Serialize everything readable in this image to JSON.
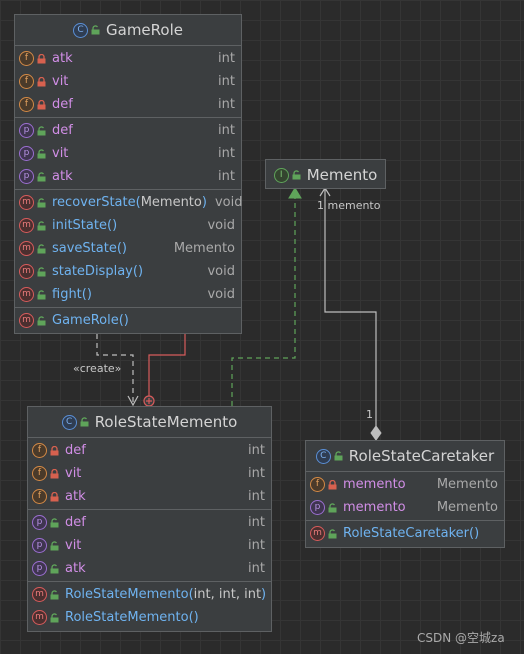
{
  "classes": [
    {
      "id": "gamerole",
      "name": "GameRole",
      "kind": "class",
      "sections": [
        [
          {
            "icon": "f",
            "access": "private",
            "name": "atk",
            "type": "int"
          },
          {
            "icon": "f",
            "access": "private",
            "name": "vit",
            "type": "int"
          },
          {
            "icon": "f",
            "access": "private",
            "name": "def",
            "type": "int"
          }
        ],
        [
          {
            "icon": "p",
            "access": "public",
            "name": "def",
            "type": "int"
          },
          {
            "icon": "p",
            "access": "public",
            "name": "vit",
            "type": "int"
          },
          {
            "icon": "p",
            "access": "public",
            "name": "atk",
            "type": "int"
          }
        ],
        [
          {
            "icon": "m",
            "access": "public",
            "name": "recoverState",
            "params": "Memento",
            "type": "void"
          },
          {
            "icon": "m",
            "access": "public",
            "name": "initState",
            "params": "",
            "type": "void"
          },
          {
            "icon": "m",
            "access": "public",
            "name": "saveState",
            "params": "",
            "type": "Memento"
          },
          {
            "icon": "m",
            "access": "public",
            "name": "stateDisplay",
            "params": "",
            "type": "void"
          },
          {
            "icon": "m",
            "access": "public",
            "name": "fight",
            "params": "",
            "type": "void"
          }
        ],
        [
          {
            "icon": "m",
            "access": "public",
            "name": "GameRole",
            "params": "",
            "type": ""
          }
        ]
      ]
    },
    {
      "id": "memento",
      "name": "Memento",
      "kind": "interface",
      "sections": []
    },
    {
      "id": "rolestatememento",
      "name": "RoleStateMemento",
      "kind": "class",
      "sections": [
        [
          {
            "icon": "f",
            "access": "private",
            "name": "def",
            "type": "int"
          },
          {
            "icon": "f",
            "access": "private",
            "name": "vit",
            "type": "int"
          },
          {
            "icon": "f",
            "access": "private",
            "name": "atk",
            "type": "int"
          }
        ],
        [
          {
            "icon": "p",
            "access": "public",
            "name": "def",
            "type": "int"
          },
          {
            "icon": "p",
            "access": "public",
            "name": "vit",
            "type": "int"
          },
          {
            "icon": "p",
            "access": "public",
            "name": "atk",
            "type": "int"
          }
        ],
        [
          {
            "icon": "m",
            "access": "public",
            "name": "RoleStateMemento",
            "params": "int, int, int",
            "type": ""
          },
          {
            "icon": "m",
            "access": "public",
            "name": "RoleStateMemento",
            "params": "",
            "type": ""
          }
        ]
      ]
    },
    {
      "id": "rolestatecaretaker",
      "name": "RoleStateCaretaker",
      "kind": "class",
      "sections": [
        [
          {
            "icon": "f",
            "access": "private",
            "name": "memento",
            "type": "Memento"
          },
          {
            "icon": "p",
            "access": "public",
            "name": "memento",
            "type": "Memento"
          }
        ],
        [
          {
            "icon": "m",
            "access": "public",
            "name": "RoleStateCaretaker",
            "params": "",
            "type": ""
          }
        ]
      ]
    }
  ],
  "labels": {
    "create": "«create»",
    "memento_mult": "1 memento",
    "caretaker_mult": "1",
    "watermark": "CSDN @空城za"
  },
  "colors": {
    "private_lock": "#d7614f",
    "public_lock": "#5fa45a",
    "create_line": "#bdbdbd",
    "implements_line": "#5fa45a",
    "inner_line": "#d75b5b",
    "aggregation_line": "#bdbdbd"
  }
}
